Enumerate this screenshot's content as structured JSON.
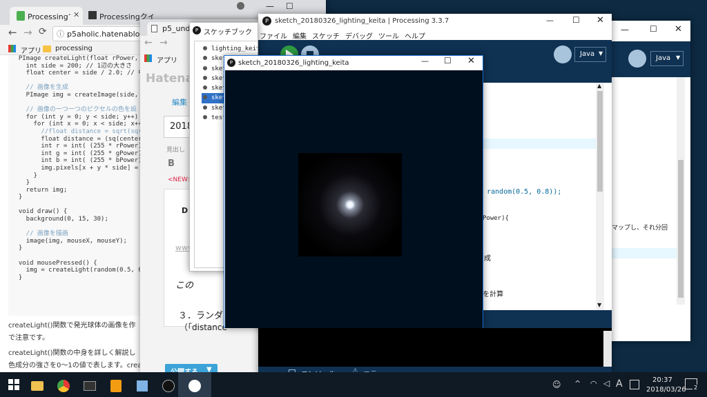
{
  "desktop_bg": "#0d2a42",
  "chrome1": {
    "tabs": [
      {
        "label": "Processingで発"
      },
      {
        "label": "Processingクイ"
      }
    ],
    "url": "p5aholic.hatenablog.co",
    "bookmark_apps": "アプリ",
    "bookmark_folder": "processing",
    "code_lines": [
      "  PImage createLight(float rPower, f",
      "    int side = 200; // 1辺の大きさ",
      "    float center = side / 2.0; // 中",
      "",
      "    // 画像を生成",
      "    PImage img = createImage(side, s",
      "",
      "    // 画像の一つ一つのピクセルの色を設",
      "    for (int y = 0; y < side; y++) {",
      "      for (int x = 0; x < side; x++)",
      "        //float distance = sqrt(sq(ce",
      "        float distance = (sq(center -",
      "        int r = int( (255 * rPower) /",
      "        int g = int( (255 * gPower) /",
      "        int b = int( (255 * bPower) /",
      "        img.pixels[x + y * side] = co",
      "      }",
      "    }",
      "    return img;",
      "  }",
      "",
      "  void draw() {",
      "    background(0, 15, 30);",
      "",
      "    // 画像を描画",
      "    image(img, mouseX, mouseY);",
      "  }",
      "",
      "  void mousePressed() {",
      "    img = createLight(random(0.5, 0.8",
      "  }"
    ],
    "para1": "createLight()関数で発光球体の画像を作",
    "para1b": "で注意です。",
    "para2": "createLight()関数の中身を詳しく解説し",
    "para2b": "色成分の強さを0〜1の値で表します。createImage()で渡さ200x200の"
  },
  "chrome2": {
    "tab": "p5_unde",
    "bookmark_apps": "アプリ",
    "logo": "Hatena",
    "tab_edit": "編集",
    "title_value": "2018",
    "heading_label": "見出し",
    "bold": "B",
    "new_tag": "<NEW>",
    "d_char": "D",
    "link": "www",
    "note": "この",
    "step3": "３．ランダム",
    "step3b": "（「distance",
    "publish": "公開する"
  },
  "sketchbook": {
    "title": "スケッチブック",
    "items": [
      {
        "label": "lighting_keita"
      },
      {
        "label": "sketch_180326_2"
      },
      {
        "label": "sketch"
      },
      {
        "label": "sketch"
      },
      {
        "label": "sketch"
      },
      {
        "label": "sketch"
      },
      {
        "label": "sketch"
      },
      {
        "label": "test"
      }
    ]
  },
  "pde": {
    "title": "sketch_20180326_lighting_keita | Processing 3.3.7",
    "menu": [
      "ファイル",
      "編集",
      "スケッチ",
      "デバッグ",
      "ツール",
      "ヘルプ"
    ],
    "mode": "Java",
    "code_frags": {
      "random": "random(0.5, 0.8));",
      "power": "Power){",
      "seisei": "成",
      "keisan": "eを計算"
    },
    "console_tab": "コンソール",
    "error_tab": "エラー"
  },
  "pde_back": {
    "mode": "Java",
    "frag": "マップし、それ分回"
  },
  "sketch_window": {
    "title": "sketch_20180326_lighting_keita",
    "canvas_bg": "#000f1e",
    "light_bg": "#00050a"
  },
  "taskbar": {
    "time": "20:37",
    "date": "2018/03/26",
    "ime": "A",
    "notif_count": "2"
  }
}
